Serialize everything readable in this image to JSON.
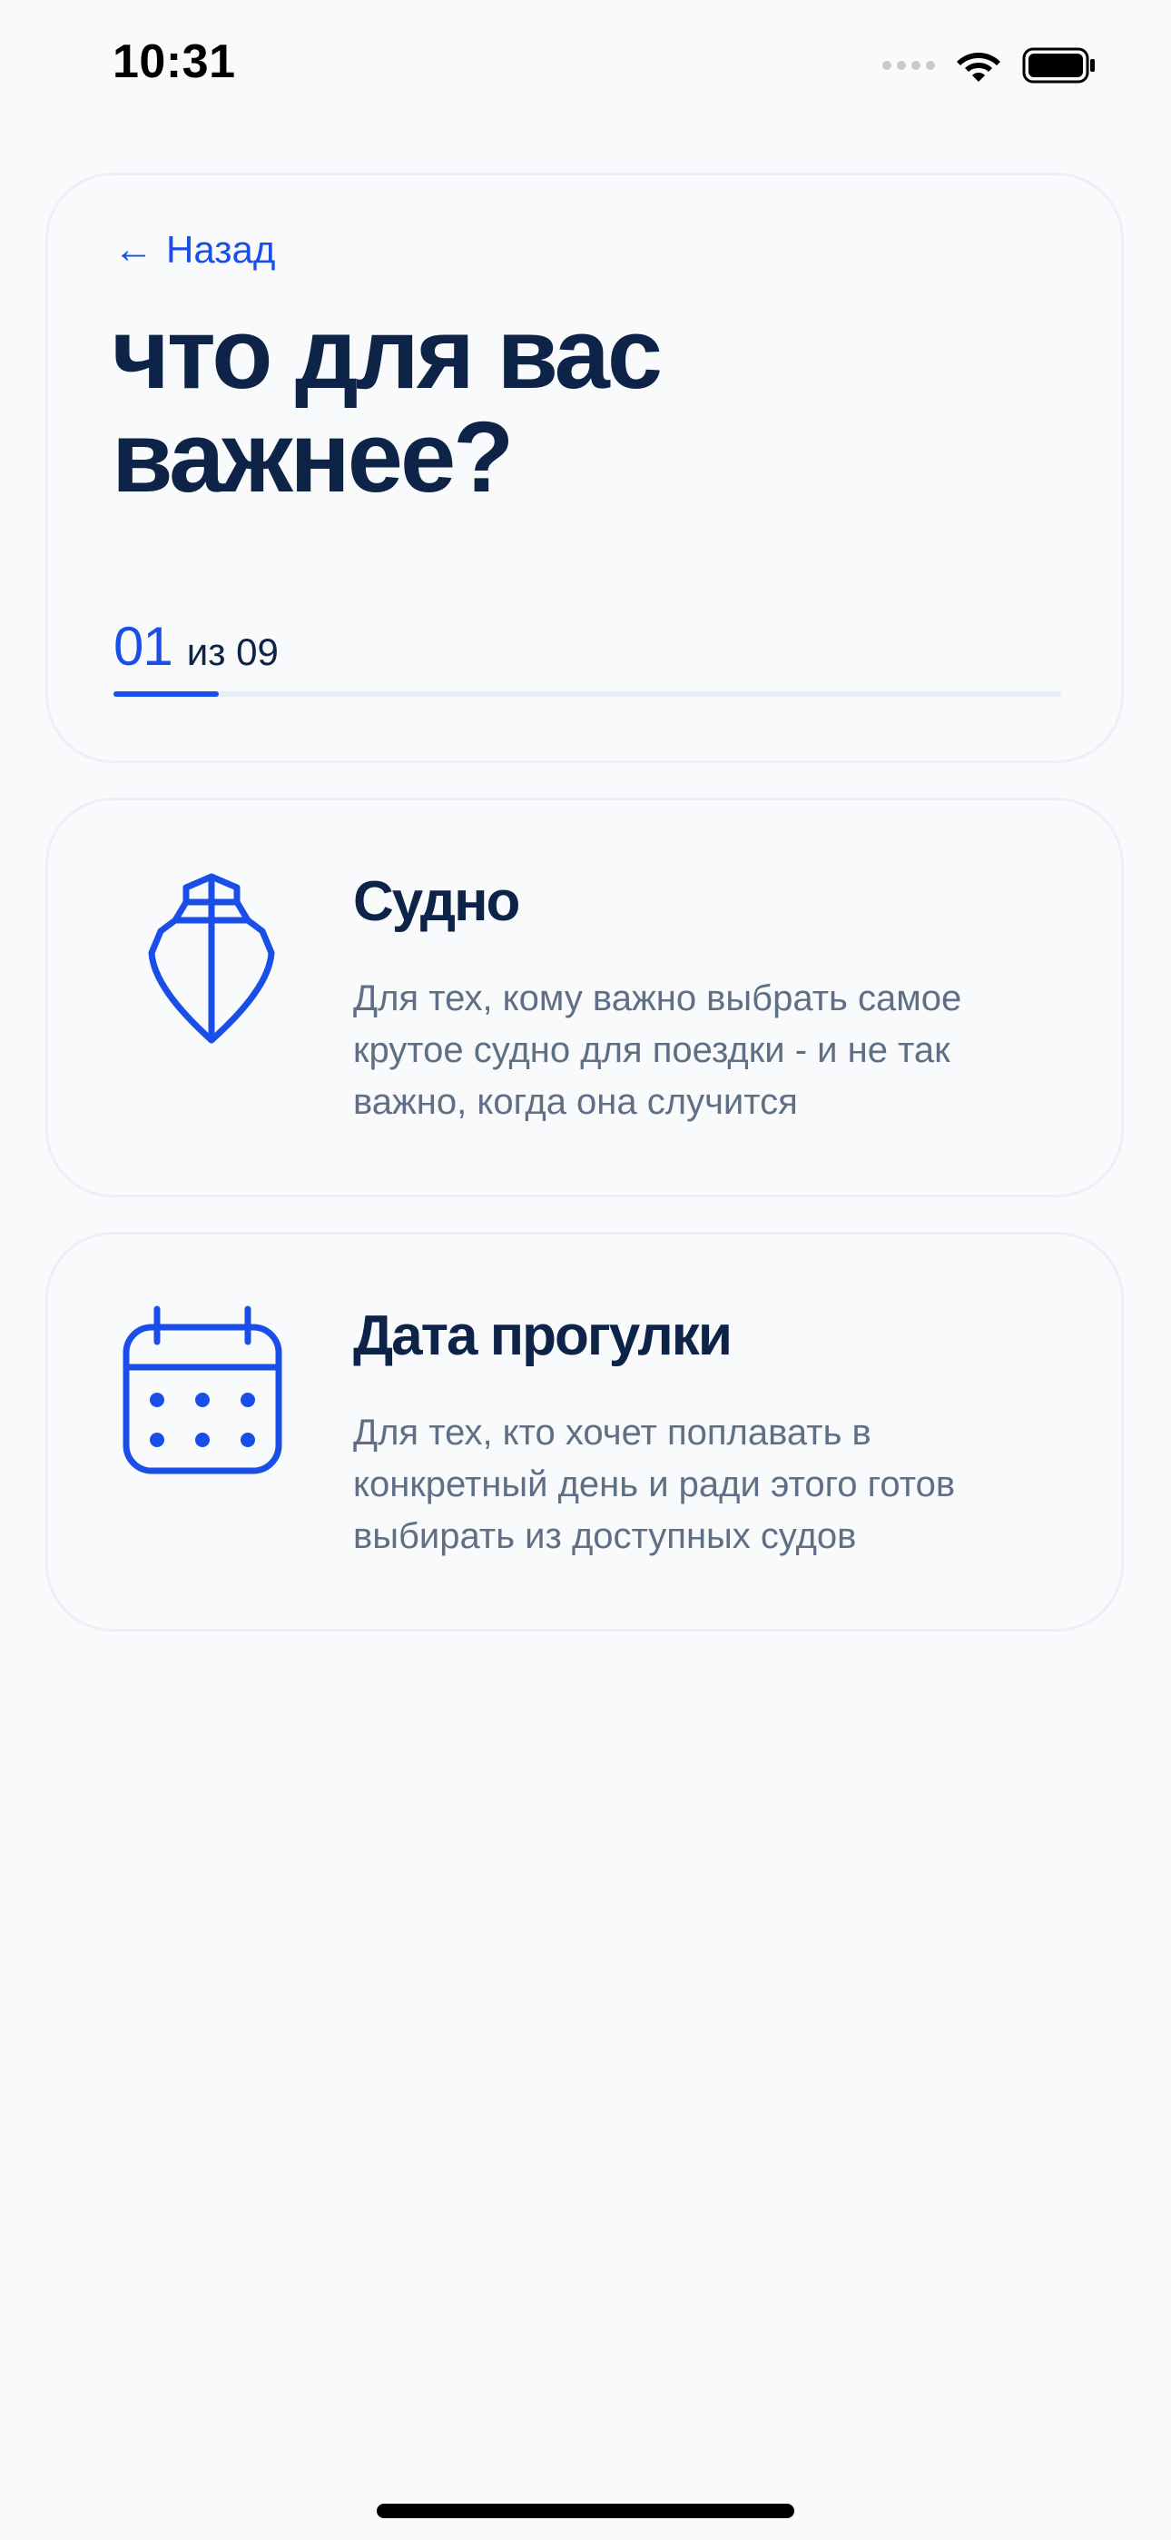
{
  "status_bar": {
    "time": "10:31",
    "icons": [
      "signal-icon",
      "wifi-icon",
      "battery-icon"
    ]
  },
  "header": {
    "back_label": "Назад",
    "back_icon": "arrow-left-icon",
    "title": "что для вас важнее?",
    "step_current": "01",
    "step_total": "из 09",
    "progress": 0.111
  },
  "options": [
    {
      "icon": "ship-icon",
      "title": "Судно",
      "description": "Для тех, кому важно выбрать самое крутое судно для поездки - и не так важно, когда она случится"
    },
    {
      "icon": "calendar-icon",
      "title": "Дата прогулки",
      "description": "Для тех, кто хочет поплавать в конкретный день и ради этого готов выбирать из доступных судов"
    }
  ],
  "colors": {
    "accent": "#1a4ee8",
    "title": "#0d2347",
    "muted": "#5f6f86",
    "background": "#f9fafb",
    "card_border": "#eceff5"
  }
}
